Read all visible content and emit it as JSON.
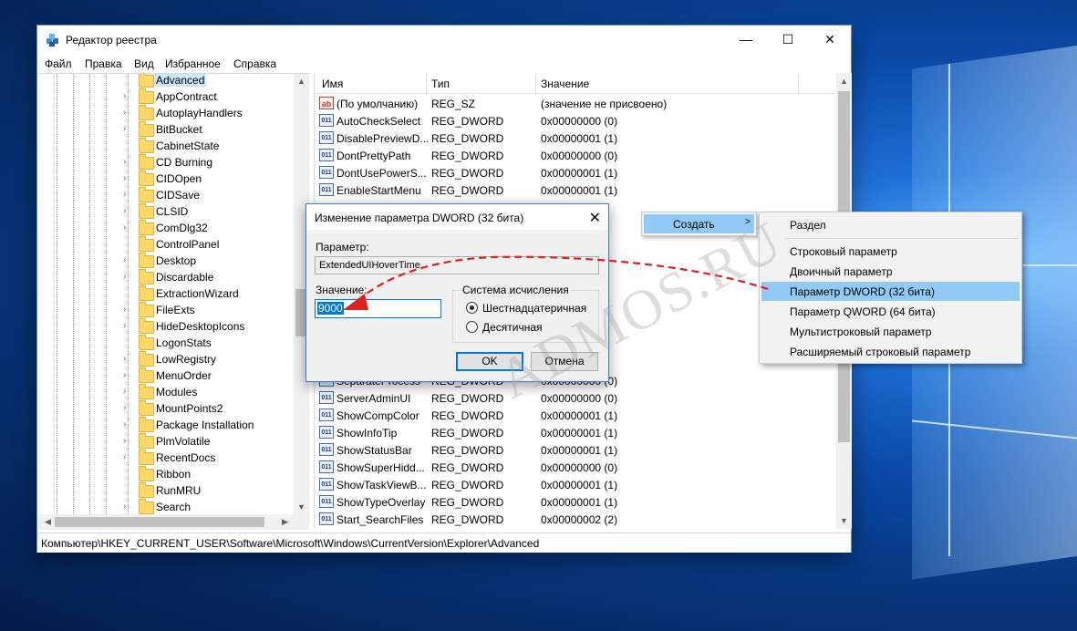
{
  "window": {
    "title": "Редактор реестра",
    "controls": {
      "minimize": "—",
      "maximize": "☐",
      "close": "✕"
    }
  },
  "menu": [
    "Файл",
    "Правка",
    "Вид",
    "Избранное",
    "Справка"
  ],
  "tree": {
    "items": [
      {
        "label": "Advanced",
        "expand": "",
        "selected": true
      },
      {
        "label": "AppContract",
        "expand": "›"
      },
      {
        "label": "AutoplayHandlers",
        "expand": "›"
      },
      {
        "label": "BitBucket",
        "expand": "›"
      },
      {
        "label": "CabinetState",
        "expand": ""
      },
      {
        "label": "CD Burning",
        "expand": "›"
      },
      {
        "label": "CIDOpen",
        "expand": "›"
      },
      {
        "label": "CIDSave",
        "expand": "›"
      },
      {
        "label": "CLSID",
        "expand": "›"
      },
      {
        "label": "ComDlg32",
        "expand": "›"
      },
      {
        "label": "ControlPanel",
        "expand": ""
      },
      {
        "label": "Desktop",
        "expand": "›"
      },
      {
        "label": "Discardable",
        "expand": "›"
      },
      {
        "label": "ExtractionWizard",
        "expand": ""
      },
      {
        "label": "FileExts",
        "expand": "›"
      },
      {
        "label": "HideDesktopIcons",
        "expand": "›"
      },
      {
        "label": "LogonStats",
        "expand": ""
      },
      {
        "label": "LowRegistry",
        "expand": "›"
      },
      {
        "label": "MenuOrder",
        "expand": "›"
      },
      {
        "label": "Modules",
        "expand": "›"
      },
      {
        "label": "MountPoints2",
        "expand": "›"
      },
      {
        "label": "Package Installation",
        "expand": "›"
      },
      {
        "label": "PlmVolatile",
        "expand": "›"
      },
      {
        "label": "RecentDocs",
        "expand": "›"
      },
      {
        "label": "Ribbon",
        "expand": ""
      },
      {
        "label": "RunMRU",
        "expand": ""
      },
      {
        "label": "Search",
        "expand": "›"
      }
    ]
  },
  "list": {
    "columns": [
      "Имя",
      "Тип",
      "Значение"
    ],
    "rows": [
      {
        "icon": "ab",
        "name": "(По умолчанию)",
        "type": "REG_SZ",
        "value": "(значение не присвоено)"
      },
      {
        "icon": "011",
        "name": "AutoCheckSelect",
        "type": "REG_DWORD",
        "value": "0x00000000 (0)"
      },
      {
        "icon": "011",
        "name": "DisablePreviewD...",
        "type": "REG_DWORD",
        "value": "0x00000001 (1)"
      },
      {
        "icon": "011",
        "name": "DontPrettyPath",
        "type": "REG_DWORD",
        "value": "0x00000000 (0)"
      },
      {
        "icon": "011",
        "name": "DontUsePowerS...",
        "type": "REG_DWORD",
        "value": "0x00000001 (1)"
      },
      {
        "icon": "011",
        "name": "EnableStartMenu",
        "type": "REG_DWORD",
        "value": "0x00000001 (1)"
      },
      {
        "icon": "011",
        "name": "SeparateProcess",
        "type": "REG_DWORD",
        "value": "0x00000000 (0)"
      },
      {
        "icon": "011",
        "name": "ServerAdminUI",
        "type": "REG_DWORD",
        "value": "0x00000000 (0)"
      },
      {
        "icon": "011",
        "name": "ShowCompColor",
        "type": "REG_DWORD",
        "value": "0x00000001 (1)"
      },
      {
        "icon": "011",
        "name": "ShowInfoTip",
        "type": "REG_DWORD",
        "value": "0x00000001 (1)"
      },
      {
        "icon": "011",
        "name": "ShowStatusBar",
        "type": "REG_DWORD",
        "value": "0x00000001 (1)"
      },
      {
        "icon": "011",
        "name": "ShowSuperHidd...",
        "type": "REG_DWORD",
        "value": "0x00000000 (0)"
      },
      {
        "icon": "011",
        "name": "ShowTaskViewB...",
        "type": "REG_DWORD",
        "value": "0x00000001 (1)"
      },
      {
        "icon": "011",
        "name": "ShowTypeOverlay",
        "type": "REG_DWORD",
        "value": "0x00000001 (1)"
      },
      {
        "icon": "011",
        "name": "Start_SearchFiles",
        "type": "REG_DWORD",
        "value": "0x00000002 (2)"
      }
    ]
  },
  "status": "Компьютер\\HKEY_CURRENT_USER\\Software\\Microsoft\\Windows\\CurrentVersion\\Explorer\\Advanced",
  "dialog": {
    "title": "Изменение параметра DWORD (32 бита)",
    "close": "✕",
    "param_label": "Параметр:",
    "param_value": "ExtendedUIHoverTime",
    "value_label": "Значение:",
    "value": "9000",
    "base_group": "Система исчисления",
    "radio_hex": "Шестнадцатеричная",
    "radio_dec": "Десятичная",
    "selected_radio": "hex",
    "ok": "OK",
    "cancel": "Отмена"
  },
  "context_menu": {
    "create": "Создать",
    "submenu": [
      "Раздел",
      "Строковый параметр",
      "Двоичный параметр",
      "Параметр DWORD (32 бита)",
      "Параметр QWORD (64 бита)",
      "Мультистроковый параметр",
      "Расширяемый строковый параметр"
    ],
    "highlighted": "Параметр DWORD (32 бита)"
  },
  "watermark": "ADMOS.RU",
  "colors": {
    "accent": "#0078d7",
    "menu_highlight": "#91c9f7",
    "arrow": "#e02020"
  }
}
